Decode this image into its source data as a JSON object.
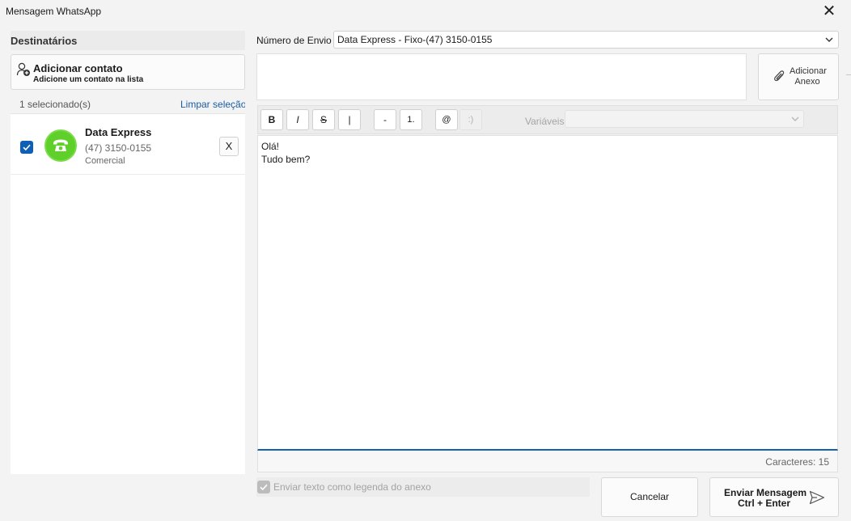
{
  "window": {
    "title": "Mensagem WhatsApp",
    "close_symbol": "✕"
  },
  "recipients": {
    "title": "Destinatários",
    "add_contact": {
      "title": "Adicionar contato",
      "subtitle": "Adicione um contato na lista",
      "icon": "add-user-icon"
    },
    "selected_count": "1 selecionado(s)",
    "clear_selection": "Limpar seleção",
    "contacts": [
      {
        "name": "Data Express",
        "phone": "(47) 3150-0155",
        "type": "Comercial",
        "checked": true,
        "remove_label": "X",
        "icon": "telephone-icon",
        "avatar_color": "#5fcf2a"
      }
    ]
  },
  "sender": {
    "label": "Número de Envio",
    "value": "Data Express - Fixo-(47) 3150-0155"
  },
  "attachment": {
    "button_line1": "Adicionar",
    "button_line2": "Anexo",
    "icon": "paperclip-icon"
  },
  "toolbar": {
    "buttons": [
      {
        "label": "B",
        "name": "bold-button"
      },
      {
        "label": "I",
        "name": "italic-button"
      },
      {
        "label": "S",
        "name": "strikethrough-button"
      },
      {
        "label": "|",
        "name": "monospace-button"
      },
      {
        "label": "-",
        "name": "bullet-list-button"
      },
      {
        "label": "1.",
        "name": "numbered-list-button"
      },
      {
        "label": "@",
        "name": "mention-button"
      },
      {
        "label": ":)",
        "name": "emoji-button"
      }
    ],
    "variables_label": "Variáveis",
    "variables_value": ""
  },
  "editor": {
    "text": "Olá!\nTudo bem?"
  },
  "char_count": "Caracteres: 15",
  "caption_option": {
    "label": "Enviar texto como legenda do anexo",
    "checked": true,
    "enabled": false
  },
  "actions": {
    "cancel": "Cancelar",
    "send_line1": "Enviar Mensagem",
    "send_line2": "Ctrl + Enter",
    "send_icon": "send-icon"
  },
  "colors": {
    "accent": "#1760b1",
    "checkbox": "#0f5fb5",
    "avatar": "#5fcf2a",
    "link": "#1a5da6"
  }
}
